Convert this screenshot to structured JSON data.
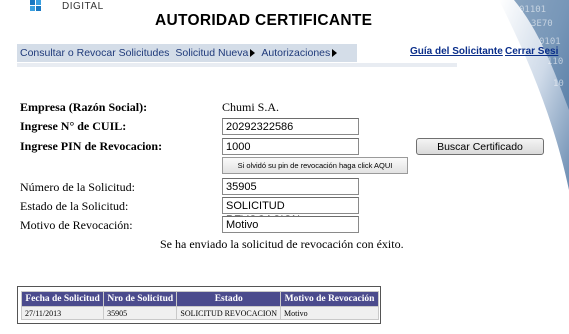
{
  "header": {
    "brand": "DIGITAL",
    "title": "AUTORIDAD CERTIFICANTE"
  },
  "nav": {
    "items": [
      {
        "label": "Consultar o Revocar Solicitudes",
        "has_arrow": false
      },
      {
        "label": "Solicitud Nueva",
        "has_arrow": true
      },
      {
        "label": "Autorizaciones",
        "has_arrow": true
      }
    ],
    "guide_link": "Guía del Solicitante",
    "logout_link": "Cerrar Sesi"
  },
  "form": {
    "empresa_label": "Empresa (Razón Social):",
    "empresa_value": "Chumi S.A.",
    "cuil_label": "Ingrese N° de CUIL:",
    "cuil_value": "20292322586",
    "pin_label": "Ingrese PIN de Revocacion:",
    "pin_value": "1000",
    "buscar_button": "Buscar Certificado",
    "olvido_button": "Si olvidó su pin de revocación haga click AQUI",
    "numero_label": "Número de la Solicitud:",
    "numero_value": "35905",
    "estado_label": "Estado de la Solicitud:",
    "estado_value": "SOLICITUD REVOCACION",
    "motivo_label": "Motivo de Revocación:",
    "motivo_value": "Motivo",
    "message": "Se ha enviado la solicitud de revocación con éxito."
  },
  "table": {
    "headers": [
      "Fecha de Solicitud",
      "Nro de Solicitud",
      "Estado",
      "Motivo de Revocación"
    ],
    "rows": [
      [
        "27/11/2013",
        "35905",
        "SOLICITUD REVOCACION",
        "Motivo"
      ]
    ]
  },
  "colors": {
    "nav_bg": "#d4dde8",
    "table_header_bg": "#4b4b8d",
    "link": "#0a2e8a"
  }
}
